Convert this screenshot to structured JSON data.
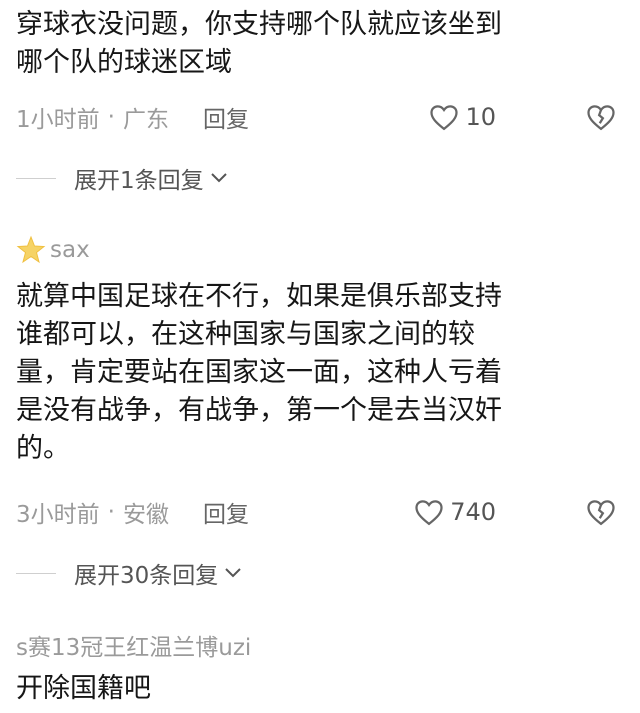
{
  "comments": [
    {
      "text_lines": [
        "穿球衣没问题，你支持哪个队就应该坐到",
        "哪个队的球迷区域"
      ],
      "time": "1小时前",
      "location": "广东",
      "reply_label": "回复",
      "likes": "10",
      "expand_label": "展开1条回复"
    },
    {
      "username": "sax",
      "text_lines": [
        "就算中国足球在不行，如果是俱乐部支持",
        "谁都可以，在这种国家与国家之间的较",
        "量，肯定要站在国家这一面，这种人亏着",
        "是没有战争，有战争，第一个是去当汉奸",
        "的。"
      ],
      "time": "3小时前",
      "location": "安徽",
      "reply_label": "回复",
      "likes": "740",
      "expand_label": "展开30条回复"
    },
    {
      "username": "s赛13冠王红温兰博uzi",
      "text_lines": [
        "开除国籍吧"
      ]
    }
  ],
  "meta_separator": "·",
  "icons": {
    "like": "heart-outline-icon",
    "dislike": "broken-heart-icon",
    "expand": "chevron-down-icon",
    "avatar": "star-avatar-icon"
  }
}
